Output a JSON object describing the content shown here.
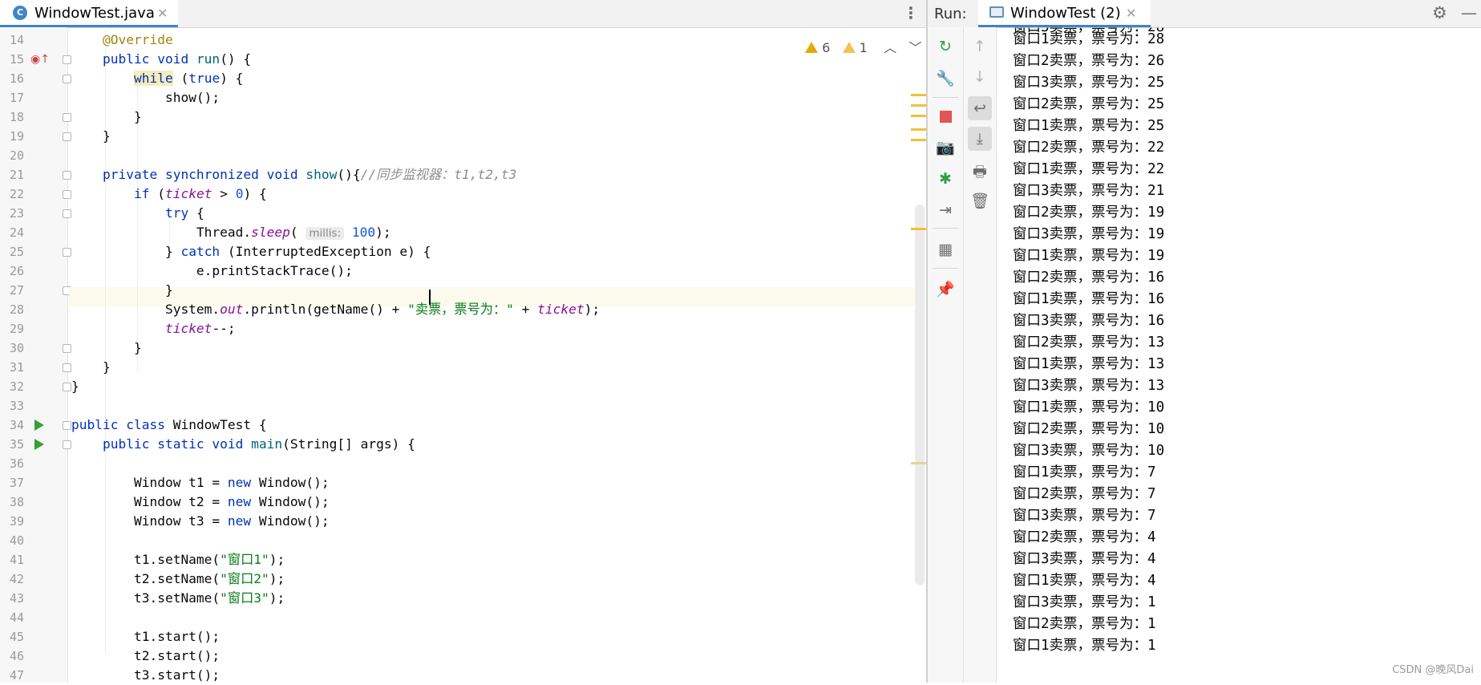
{
  "editor": {
    "tab_title": "WindowTest.java",
    "tab_icon_letter": "C",
    "inspections": {
      "warnings": "6",
      "weak_warnings": "1"
    },
    "lines": [
      {
        "n": "14",
        "tokens": [
          {
            "t": "    "
          },
          {
            "t": "@Override",
            "c": "ann"
          }
        ]
      },
      {
        "n": "15",
        "tokens": [
          {
            "t": "    "
          },
          {
            "t": "public void ",
            "c": "kw"
          },
          {
            "t": "run",
            "c": "fn"
          },
          {
            "t": "() {"
          }
        ]
      },
      {
        "n": "16",
        "tokens": [
          {
            "t": "        "
          },
          {
            "t": "while",
            "c": "kw hl-while"
          },
          {
            "t": " ("
          },
          {
            "t": "true",
            "c": "kw"
          },
          {
            "t": ") {"
          }
        ]
      },
      {
        "n": "17",
        "tokens": [
          {
            "t": "            show();"
          }
        ]
      },
      {
        "n": "18",
        "tokens": [
          {
            "t": "        }"
          }
        ]
      },
      {
        "n": "19",
        "tokens": [
          {
            "t": "    }"
          }
        ]
      },
      {
        "n": "20",
        "tokens": []
      },
      {
        "n": "21",
        "tokens": [
          {
            "t": "    "
          },
          {
            "t": "private synchronized void ",
            "c": "kw"
          },
          {
            "t": "show",
            "c": "fn"
          },
          {
            "t": "(){"
          },
          {
            "t": "//同步监视器：t1,t2,t3",
            "c": "cmt"
          }
        ]
      },
      {
        "n": "22",
        "tokens": [
          {
            "t": "        "
          },
          {
            "t": "if",
            "c": "kw"
          },
          {
            "t": " ("
          },
          {
            "t": "ticket",
            "c": "fld"
          },
          {
            "t": " > "
          },
          {
            "t": "0",
            "c": "num"
          },
          {
            "t": ") {"
          }
        ]
      },
      {
        "n": "23",
        "tokens": [
          {
            "t": "            "
          },
          {
            "t": "try",
            "c": "kw"
          },
          {
            "t": " {"
          }
        ]
      },
      {
        "n": "24",
        "tokens": [
          {
            "t": "                Thread."
          },
          {
            "t": "sleep",
            "c": "fld"
          },
          {
            "t": "( "
          },
          {
            "t": "millis:",
            "c": "hint"
          },
          {
            "t": " "
          },
          {
            "t": "100",
            "c": "num"
          },
          {
            "t": ");"
          }
        ]
      },
      {
        "n": "25",
        "tokens": [
          {
            "t": "            } "
          },
          {
            "t": "catch",
            "c": "kw"
          },
          {
            "t": " (InterruptedException e) {"
          }
        ]
      },
      {
        "n": "26",
        "tokens": [
          {
            "t": "                e.printStackTrace();"
          }
        ]
      },
      {
        "n": "27",
        "tokens": [
          {
            "t": "            }"
          }
        ]
      },
      {
        "n": "28",
        "tokens": [
          {
            "t": "            System."
          },
          {
            "t": "out",
            "c": "fld"
          },
          {
            "t": ".println(getName() + "
          },
          {
            "t": "\"卖票，票号为：\"",
            "c": "str"
          },
          {
            "t": " + "
          },
          {
            "t": "ticket",
            "c": "fld"
          },
          {
            "t": ");"
          }
        ]
      },
      {
        "n": "29",
        "tokens": [
          {
            "t": "            "
          },
          {
            "t": "ticket",
            "c": "fld"
          },
          {
            "t": "--;"
          }
        ]
      },
      {
        "n": "30",
        "tokens": [
          {
            "t": "        }"
          }
        ]
      },
      {
        "n": "31",
        "tokens": [
          {
            "t": "    }"
          }
        ]
      },
      {
        "n": "32",
        "tokens": [
          {
            "t": "}"
          }
        ]
      },
      {
        "n": "33",
        "tokens": []
      },
      {
        "n": "34",
        "tokens": [
          {
            "t": "public class ",
            "c": "kw"
          },
          {
            "t": "WindowTest {"
          }
        ]
      },
      {
        "n": "35",
        "tokens": [
          {
            "t": "    "
          },
          {
            "t": "public static void ",
            "c": "kw"
          },
          {
            "t": "main",
            "c": "fn"
          },
          {
            "t": "(String[] args) {"
          }
        ]
      },
      {
        "n": "36",
        "tokens": []
      },
      {
        "n": "37",
        "tokens": [
          {
            "t": "        Window t1 = "
          },
          {
            "t": "new",
            "c": "kw"
          },
          {
            "t": " Window();"
          }
        ]
      },
      {
        "n": "38",
        "tokens": [
          {
            "t": "        Window t2 = "
          },
          {
            "t": "new",
            "c": "kw"
          },
          {
            "t": " Window();"
          }
        ]
      },
      {
        "n": "39",
        "tokens": [
          {
            "t": "        Window t3 = "
          },
          {
            "t": "new",
            "c": "kw"
          },
          {
            "t": " Window();"
          }
        ]
      },
      {
        "n": "40",
        "tokens": []
      },
      {
        "n": "41",
        "tokens": [
          {
            "t": "        t1.setName("
          },
          {
            "t": "\"窗口1\"",
            "c": "str"
          },
          {
            "t": ");"
          }
        ]
      },
      {
        "n": "42",
        "tokens": [
          {
            "t": "        t2.setName("
          },
          {
            "t": "\"窗口2\"",
            "c": "str"
          },
          {
            "t": ");"
          }
        ]
      },
      {
        "n": "43",
        "tokens": [
          {
            "t": "        t3.setName("
          },
          {
            "t": "\"窗口3\"",
            "c": "str"
          },
          {
            "t": ");"
          }
        ]
      },
      {
        "n": "44",
        "tokens": []
      },
      {
        "n": "45",
        "tokens": [
          {
            "t": "        t1.start();"
          }
        ]
      },
      {
        "n": "46",
        "tokens": [
          {
            "t": "        t2.start();"
          }
        ]
      },
      {
        "n": "47",
        "tokens": [
          {
            "t": "        t3.start();"
          }
        ]
      }
    ]
  },
  "run": {
    "label": "Run:",
    "tab_title": "WindowTest (2)",
    "console": [
      "窗口1卖票，票号为：28",
      "窗口2卖票，票号为：26",
      "窗口3卖票，票号为：25",
      "窗口2卖票，票号为：25",
      "窗口1卖票，票号为：25",
      "窗口2卖票，票号为：22",
      "窗口1卖票，票号为：22",
      "窗口3卖票，票号为：21",
      "窗口2卖票，票号为：19",
      "窗口3卖票，票号为：19",
      "窗口1卖票，票号为：19",
      "窗口2卖票，票号为：16",
      "窗口1卖票，票号为：16",
      "窗口3卖票，票号为：16",
      "窗口2卖票，票号为：13",
      "窗口1卖票，票号为：13",
      "窗口3卖票，票号为：13",
      "窗口1卖票，票号为：10",
      "窗口2卖票，票号为：10",
      "窗口3卖票，票号为：10",
      "窗口1卖票，票号为：7",
      "窗口2卖票，票号为：7",
      "窗口3卖票，票号为：7",
      "窗口2卖票，票号为：4",
      "窗口3卖票，票号为：4",
      "窗口1卖票，票号为：4",
      "窗口3卖票，票号为：1",
      "窗口2卖票，票号为：1",
      "窗口1卖票，票号为：1"
    ]
  },
  "watermark": "CSDN @晚风Dai",
  "icons": {
    "rerun": "rerun-icon",
    "settings": "wrench-icon",
    "stop": "stop-icon",
    "snapshot": "camera-icon",
    "debug": "debug-icon",
    "restore": "restore-layout-icon",
    "layout": "layout-icon",
    "pin": "pin-icon",
    "up": "arrow-up-icon",
    "down": "arrow-down-icon",
    "wrap": "soft-wrap-icon",
    "scroll": "scroll-to-end-icon",
    "print": "print-icon",
    "trash": "trash-icon",
    "gear": "gear-icon",
    "minimize": "minimize-icon"
  }
}
